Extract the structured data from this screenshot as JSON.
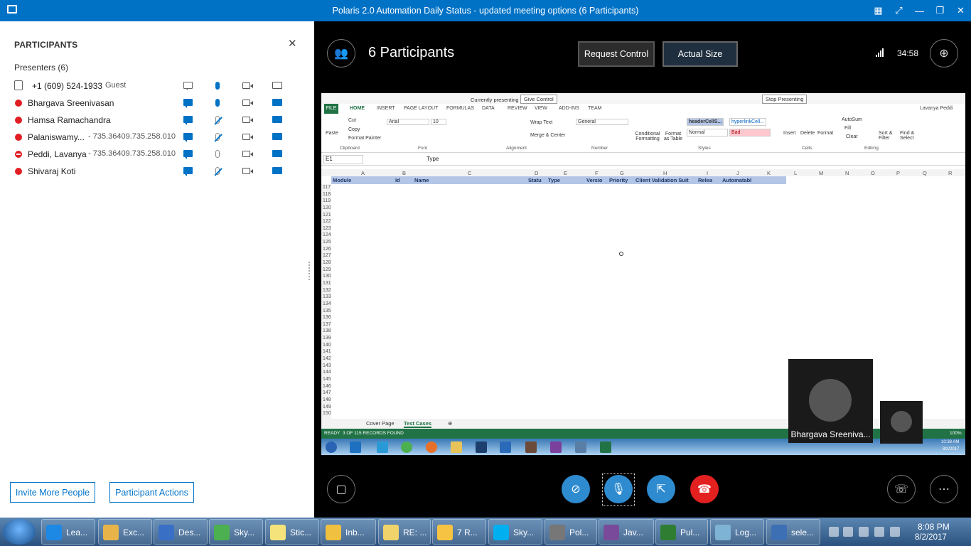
{
  "window": {
    "title": "Polaris 2.0 Automation Daily Status - updated meeting options (6 Participants)"
  },
  "participants_panel": {
    "title": "PARTICIPANTS",
    "presenters_label": "Presenters (6)",
    "rows": [
      {
        "name": "+1 (609) 524-1933",
        "meta": "Guest",
        "type": "phone"
      },
      {
        "name": "Bhargava Sreenivasan",
        "meta": "",
        "type": "dot"
      },
      {
        "name": "Hamsa Ramachandra",
        "meta": "",
        "type": "dot"
      },
      {
        "name": "Palaniswamy...",
        "meta": "- 735.36409.735.258.010",
        "type": "dot"
      },
      {
        "name": "Peddi, Lavanya",
        "meta": "- 735.36409.735.258.010",
        "type": "blocked"
      },
      {
        "name": "Shivaraj Koti",
        "meta": "",
        "type": "dot"
      }
    ],
    "invite_button": "Invite More People",
    "actions_button": "Participant Actions"
  },
  "stage": {
    "participant_count": "6 Participants",
    "request_control": "Request Control",
    "actual_size": "Actual Size",
    "timer": "34:58",
    "video_name": "Bhargava Sreeniva..."
  },
  "excel": {
    "currently_presenting": "Currently presenting",
    "give_control": "Give Control",
    "stop_presenting": "Stop Presenting",
    "user": "Lavanya Peddi",
    "tabs": [
      "FILE",
      "HOME",
      "INSERT",
      "PAGE LAYOUT",
      "FORMULAS",
      "DATA",
      "REVIEW",
      "VIEW",
      "ADD-INS",
      "TEAM"
    ],
    "ribbon": {
      "cut": "Cut",
      "copy": "Copy",
      "format_painter": "Format Painter",
      "paste": "Paste",
      "clipboard": "Clipboard",
      "font_name": "Arial",
      "font_size": "10",
      "font": "Font",
      "wrap_text": "Wrap Text",
      "merge_center": "Merge & Center",
      "alignment": "Alignment",
      "number_format": "General",
      "number": "Number",
      "conditional": "Conditional Formatting",
      "format_table": "Format as Table",
      "style_header": "headerCellS...",
      "style_link": "hyperlinkCell...",
      "style_normal": "Normal",
      "style_bad": "Bad",
      "styles": "Styles",
      "insert": "Insert",
      "delete": "Delete",
      "format": "Format",
      "cells": "Cells",
      "autosum": "AutoSum",
      "fill": "Fill",
      "clear": "Clear",
      "sort_filter": "Sort & Filter",
      "find_select": "Find & Select",
      "editing": "Editing"
    },
    "name_box": "E1",
    "formula": "Type",
    "columns": [
      "A",
      "B",
      "C",
      "D",
      "E",
      "F",
      "G",
      "H",
      "I",
      "J",
      "K",
      "L",
      "M",
      "N",
      "O",
      "P",
      "Q",
      "R"
    ],
    "headers": [
      "Module",
      "Id",
      "Name",
      "Statu",
      "Type",
      "Versio",
      "Priority",
      "Client Validation Suit",
      "Relea",
      "Automatabl"
    ],
    "row_numbers": [
      "117",
      "118",
      "119",
      "120",
      "121",
      "122",
      "123",
      "124",
      "125",
      "126",
      "127",
      "128",
      "129",
      "130",
      "131",
      "132",
      "133",
      "134",
      "135",
      "136",
      "137",
      "138",
      "139",
      "140",
      "141",
      "142",
      "143",
      "144",
      "145",
      "146",
      "147",
      "148",
      "149",
      "150"
    ],
    "sheet_tabs": [
      "Cover Page",
      "Test Cases"
    ],
    "status": "READY",
    "records": "3 OF 115 RECORDS FOUND",
    "zoom": "100%",
    "mini_clock_time": "10:38 AM",
    "mini_clock_date": "8/2/2017"
  },
  "taskbar": {
    "items": [
      {
        "label": "Lea...",
        "color": "#1e88e5"
      },
      {
        "label": "Exc...",
        "color": "#e8b44a"
      },
      {
        "label": "Des...",
        "color": "#3a6fc6"
      },
      {
        "label": "Sky...",
        "color": "#4caf50"
      },
      {
        "label": "Stic...",
        "color": "#f3e37a"
      },
      {
        "label": "Inb...",
        "color": "#f0c040"
      },
      {
        "label": "RE: ...",
        "color": "#f1d36b"
      },
      {
        "label": "7 R...",
        "color": "#f6c342"
      },
      {
        "label": "Sky...",
        "color": "#00aff0"
      },
      {
        "label": "Pol...",
        "color": "#777777"
      },
      {
        "label": "Jav...",
        "color": "#7a4a9a"
      },
      {
        "label": "Pul...",
        "color": "#2e7d32"
      },
      {
        "label": "Log...",
        "color": "#7fb3d5"
      },
      {
        "label": "sele...",
        "color": "#3d6fb5"
      }
    ],
    "time": "8:08 PM",
    "date": "8/2/2017"
  }
}
